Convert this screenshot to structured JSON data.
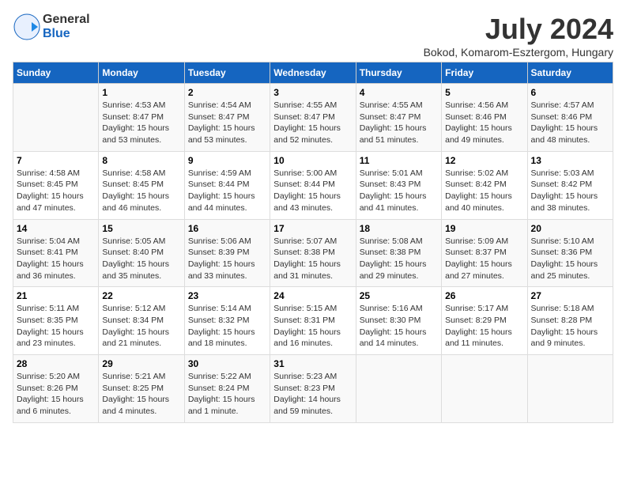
{
  "header": {
    "logo_general": "General",
    "logo_blue": "Blue",
    "month_title": "July 2024",
    "subtitle": "Bokod, Komarom-Esztergom, Hungary"
  },
  "calendar": {
    "days_of_week": [
      "Sunday",
      "Monday",
      "Tuesday",
      "Wednesday",
      "Thursday",
      "Friday",
      "Saturday"
    ],
    "weeks": [
      [
        {
          "day": "",
          "info": ""
        },
        {
          "day": "1",
          "info": "Sunrise: 4:53 AM\nSunset: 8:47 PM\nDaylight: 15 hours\nand 53 minutes."
        },
        {
          "day": "2",
          "info": "Sunrise: 4:54 AM\nSunset: 8:47 PM\nDaylight: 15 hours\nand 53 minutes."
        },
        {
          "day": "3",
          "info": "Sunrise: 4:55 AM\nSunset: 8:47 PM\nDaylight: 15 hours\nand 52 minutes."
        },
        {
          "day": "4",
          "info": "Sunrise: 4:55 AM\nSunset: 8:47 PM\nDaylight: 15 hours\nand 51 minutes."
        },
        {
          "day": "5",
          "info": "Sunrise: 4:56 AM\nSunset: 8:46 PM\nDaylight: 15 hours\nand 49 minutes."
        },
        {
          "day": "6",
          "info": "Sunrise: 4:57 AM\nSunset: 8:46 PM\nDaylight: 15 hours\nand 48 minutes."
        }
      ],
      [
        {
          "day": "7",
          "info": "Sunrise: 4:58 AM\nSunset: 8:45 PM\nDaylight: 15 hours\nand 47 minutes."
        },
        {
          "day": "8",
          "info": "Sunrise: 4:58 AM\nSunset: 8:45 PM\nDaylight: 15 hours\nand 46 minutes."
        },
        {
          "day": "9",
          "info": "Sunrise: 4:59 AM\nSunset: 8:44 PM\nDaylight: 15 hours\nand 44 minutes."
        },
        {
          "day": "10",
          "info": "Sunrise: 5:00 AM\nSunset: 8:44 PM\nDaylight: 15 hours\nand 43 minutes."
        },
        {
          "day": "11",
          "info": "Sunrise: 5:01 AM\nSunset: 8:43 PM\nDaylight: 15 hours\nand 41 minutes."
        },
        {
          "day": "12",
          "info": "Sunrise: 5:02 AM\nSunset: 8:42 PM\nDaylight: 15 hours\nand 40 minutes."
        },
        {
          "day": "13",
          "info": "Sunrise: 5:03 AM\nSunset: 8:42 PM\nDaylight: 15 hours\nand 38 minutes."
        }
      ],
      [
        {
          "day": "14",
          "info": "Sunrise: 5:04 AM\nSunset: 8:41 PM\nDaylight: 15 hours\nand 36 minutes."
        },
        {
          "day": "15",
          "info": "Sunrise: 5:05 AM\nSunset: 8:40 PM\nDaylight: 15 hours\nand 35 minutes."
        },
        {
          "day": "16",
          "info": "Sunrise: 5:06 AM\nSunset: 8:39 PM\nDaylight: 15 hours\nand 33 minutes."
        },
        {
          "day": "17",
          "info": "Sunrise: 5:07 AM\nSunset: 8:38 PM\nDaylight: 15 hours\nand 31 minutes."
        },
        {
          "day": "18",
          "info": "Sunrise: 5:08 AM\nSunset: 8:38 PM\nDaylight: 15 hours\nand 29 minutes."
        },
        {
          "day": "19",
          "info": "Sunrise: 5:09 AM\nSunset: 8:37 PM\nDaylight: 15 hours\nand 27 minutes."
        },
        {
          "day": "20",
          "info": "Sunrise: 5:10 AM\nSunset: 8:36 PM\nDaylight: 15 hours\nand 25 minutes."
        }
      ],
      [
        {
          "day": "21",
          "info": "Sunrise: 5:11 AM\nSunset: 8:35 PM\nDaylight: 15 hours\nand 23 minutes."
        },
        {
          "day": "22",
          "info": "Sunrise: 5:12 AM\nSunset: 8:34 PM\nDaylight: 15 hours\nand 21 minutes."
        },
        {
          "day": "23",
          "info": "Sunrise: 5:14 AM\nSunset: 8:32 PM\nDaylight: 15 hours\nand 18 minutes."
        },
        {
          "day": "24",
          "info": "Sunrise: 5:15 AM\nSunset: 8:31 PM\nDaylight: 15 hours\nand 16 minutes."
        },
        {
          "day": "25",
          "info": "Sunrise: 5:16 AM\nSunset: 8:30 PM\nDaylight: 15 hours\nand 14 minutes."
        },
        {
          "day": "26",
          "info": "Sunrise: 5:17 AM\nSunset: 8:29 PM\nDaylight: 15 hours\nand 11 minutes."
        },
        {
          "day": "27",
          "info": "Sunrise: 5:18 AM\nSunset: 8:28 PM\nDaylight: 15 hours\nand 9 minutes."
        }
      ],
      [
        {
          "day": "28",
          "info": "Sunrise: 5:20 AM\nSunset: 8:26 PM\nDaylight: 15 hours\nand 6 minutes."
        },
        {
          "day": "29",
          "info": "Sunrise: 5:21 AM\nSunset: 8:25 PM\nDaylight: 15 hours\nand 4 minutes."
        },
        {
          "day": "30",
          "info": "Sunrise: 5:22 AM\nSunset: 8:24 PM\nDaylight: 15 hours\nand 1 minute."
        },
        {
          "day": "31",
          "info": "Sunrise: 5:23 AM\nSunset: 8:23 PM\nDaylight: 14 hours\nand 59 minutes."
        },
        {
          "day": "",
          "info": ""
        },
        {
          "day": "",
          "info": ""
        },
        {
          "day": "",
          "info": ""
        }
      ]
    ]
  }
}
